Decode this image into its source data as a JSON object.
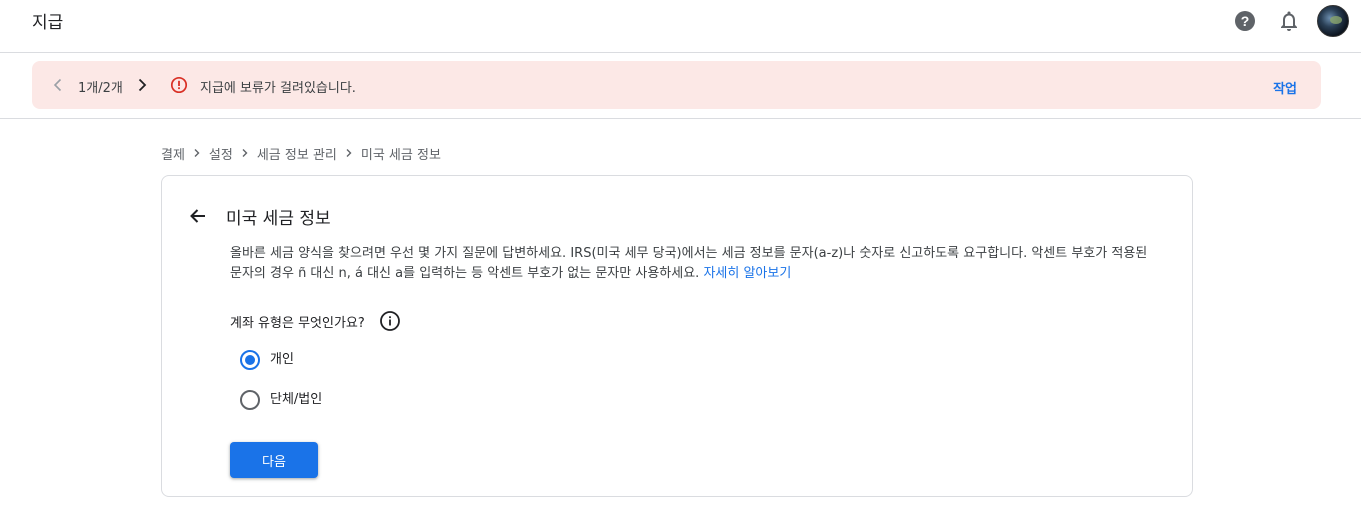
{
  "header": {
    "title": "지급",
    "icons": [
      "help-icon",
      "bell-icon",
      "avatar"
    ]
  },
  "alert": {
    "counter": "1개/2개",
    "message": "지급에 보류가 걸려있습니다.",
    "action_label": "작업",
    "background": "#fce8e6",
    "icon_color": "#d93025"
  },
  "breadcrumb": {
    "items": [
      "결제",
      "설정",
      "세금 정보 관리",
      "미국 세금 정보"
    ]
  },
  "card": {
    "title": "미국 세금 정보",
    "description": "올바른 세금 양식을 찾으려면 우선 몇 가지 질문에 답변하세요. IRS(미국 세무 당국)에서는 세금 정보를 문자(a-z)나 숫자로 신고하도록 요구합니다. 악센트 부호가 적용된 문자의 경우 ñ 대신 n, á 대신 a를 입력하는 등 악센트 부호가 없는 문자만 사용하세요.",
    "learn_more": "자세히 알아보기",
    "question": "계좌 유형은 무엇인가요?",
    "options": [
      {
        "label": "개인",
        "selected": true
      },
      {
        "label": "단체/법인",
        "selected": false
      }
    ],
    "next_label": "다음"
  },
  "colors": {
    "accent": "#1a73e8",
    "divider": "#dadce0"
  }
}
